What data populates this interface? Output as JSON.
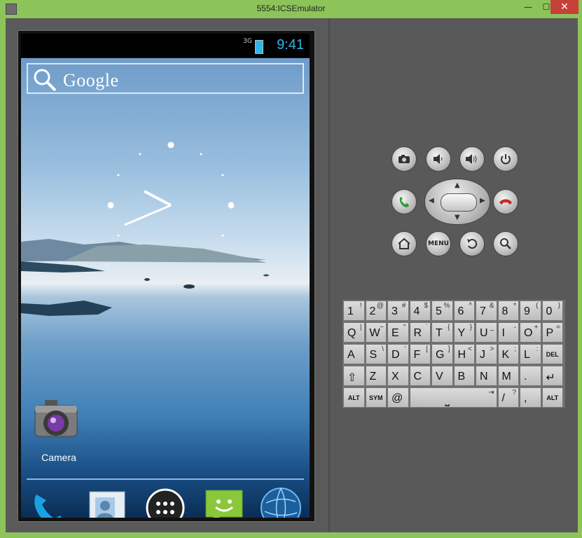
{
  "window": {
    "title": "5554:ICSEmulator",
    "min": "—",
    "max": "☐",
    "close": "✕"
  },
  "status": {
    "network": "3G",
    "time": "9:41"
  },
  "search": {
    "label": "Google"
  },
  "home": {
    "camera_label": "Camera"
  },
  "dock": [
    "phone-icon",
    "contacts-icon",
    "apps-icon",
    "messaging-icon",
    "browser-icon"
  ],
  "controls": {
    "menu_label": "MENU"
  },
  "keyboard": {
    "rows": [
      [
        {
          "m": "1",
          "s": "!"
        },
        {
          "m": "2",
          "s": "@"
        },
        {
          "m": "3",
          "s": "#"
        },
        {
          "m": "4",
          "s": "$"
        },
        {
          "m": "5",
          "s": "%"
        },
        {
          "m": "6",
          "s": "^"
        },
        {
          "m": "7",
          "s": "&"
        },
        {
          "m": "8",
          "s": "*"
        },
        {
          "m": "9",
          "s": "("
        },
        {
          "m": "0",
          "s": ")"
        }
      ],
      [
        {
          "m": "Q",
          "s": "|"
        },
        {
          "m": "W",
          "s": "~"
        },
        {
          "m": "E",
          "s": "\""
        },
        {
          "m": "R",
          "s": "`"
        },
        {
          "m": "T",
          "s": "{"
        },
        {
          "m": "Y",
          "s": "}"
        },
        {
          "m": "U",
          "s": "_"
        },
        {
          "m": "I",
          "s": "-"
        },
        {
          "m": "O",
          "s": "+"
        },
        {
          "m": "P",
          "s": "="
        }
      ],
      [
        {
          "m": "A",
          "s": ""
        },
        {
          "m": "S",
          "s": "\\"
        },
        {
          "m": "D",
          "s": "'"
        },
        {
          "m": "F",
          "s": "["
        },
        {
          "m": "G",
          "s": "]"
        },
        {
          "m": "H",
          "s": "<"
        },
        {
          "m": "J",
          "s": ">"
        },
        {
          "m": "K",
          "s": ";"
        },
        {
          "m": "L",
          "s": ":"
        },
        {
          "m": "DEL",
          "s": ""
        }
      ],
      [
        {
          "m": "⇧",
          "s": ""
        },
        {
          "m": "Z",
          "s": ""
        },
        {
          "m": "X",
          "s": ""
        },
        {
          "m": "C",
          "s": ""
        },
        {
          "m": "V",
          "s": ""
        },
        {
          "m": "B",
          "s": ""
        },
        {
          "m": "N",
          "s": ""
        },
        {
          "m": "M",
          "s": ""
        },
        {
          "m": ".",
          "s": ""
        },
        {
          "m": "↵",
          "s": ""
        }
      ],
      [
        {
          "m": "ALT",
          "s": ""
        },
        {
          "m": "SYM",
          "s": ""
        },
        {
          "m": "@",
          "s": ""
        },
        {
          "m": "⎵",
          "s": "⇥"
        },
        {
          "m": "/",
          "s": "?"
        },
        {
          "m": ",",
          "s": ""
        },
        {
          "m": "ALT",
          "s": ""
        }
      ]
    ]
  }
}
